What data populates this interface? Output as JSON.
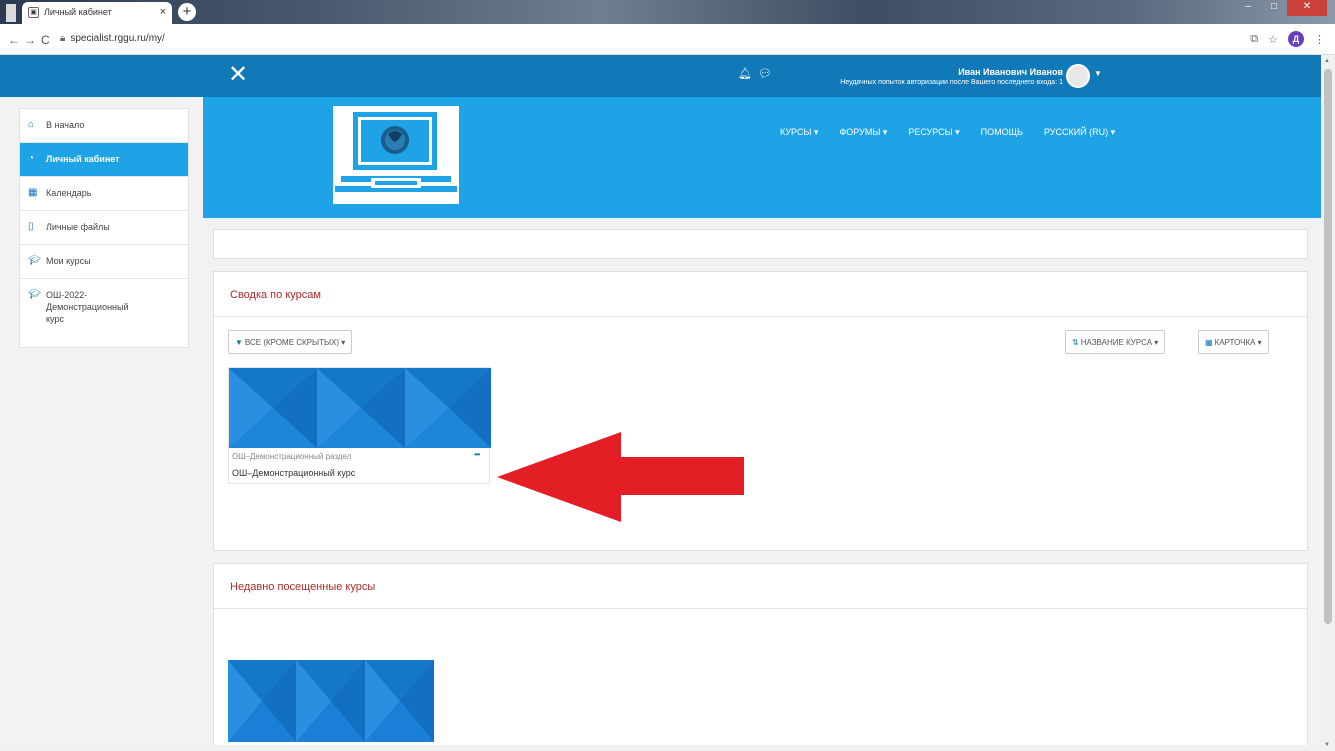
{
  "browser": {
    "tab_title": "Личный кабинет",
    "tab_close": "×",
    "new_tab": "+",
    "url": "specialist.rggu.ru/my/",
    "back": "←",
    "forward": "→",
    "reload": "C",
    "profile_letter": "Д"
  },
  "navbar": {
    "close_drawer": "✕",
    "user_name": "Иван Иванович Иванов",
    "login_notice": "Неудачных попыток авторизации после Вашего последнего входа: 1"
  },
  "topmenu": [
    "КУРСЫ ▾",
    "ФОРУМЫ ▾",
    "РЕСУРСЫ ▾",
    "ПОМОЩЬ",
    "РУССКИЙ (RU) ▾"
  ],
  "sidebar": {
    "items": [
      {
        "label": "В начало",
        "icon": "home-icon"
      },
      {
        "label": "Личный кабинет",
        "icon": "dashboard-icon"
      },
      {
        "label": "Календарь",
        "icon": "calendar-icon"
      },
      {
        "label": "Личные файлы",
        "icon": "file-icon"
      },
      {
        "label": "Мои курсы",
        "icon": "graduation-cap-icon"
      },
      {
        "label": "ОШ-2022-Демонстрационный курс",
        "icon": "graduation-cap-icon"
      }
    ]
  },
  "overview": {
    "title": "Сводка по курсам",
    "filter_label": "ВСЕ (КРОМЕ СКРЫТЫХ) ▾",
    "sort_label": "НАЗВАНИЕ КУРСА ▾",
    "view_label": "КАРТОЧКА ▾",
    "course": {
      "category": "ОШ–Демонстрационный раздел",
      "name": "ОШ–Демонстрационный курс",
      "menu": "•••"
    }
  },
  "recent": {
    "title": "Недавно посещенные курсы"
  },
  "colors": {
    "navbar": "#1179b8",
    "banner": "#1ea3e6",
    "arrow": "#e31e24",
    "card_title": "#b02a2a"
  }
}
